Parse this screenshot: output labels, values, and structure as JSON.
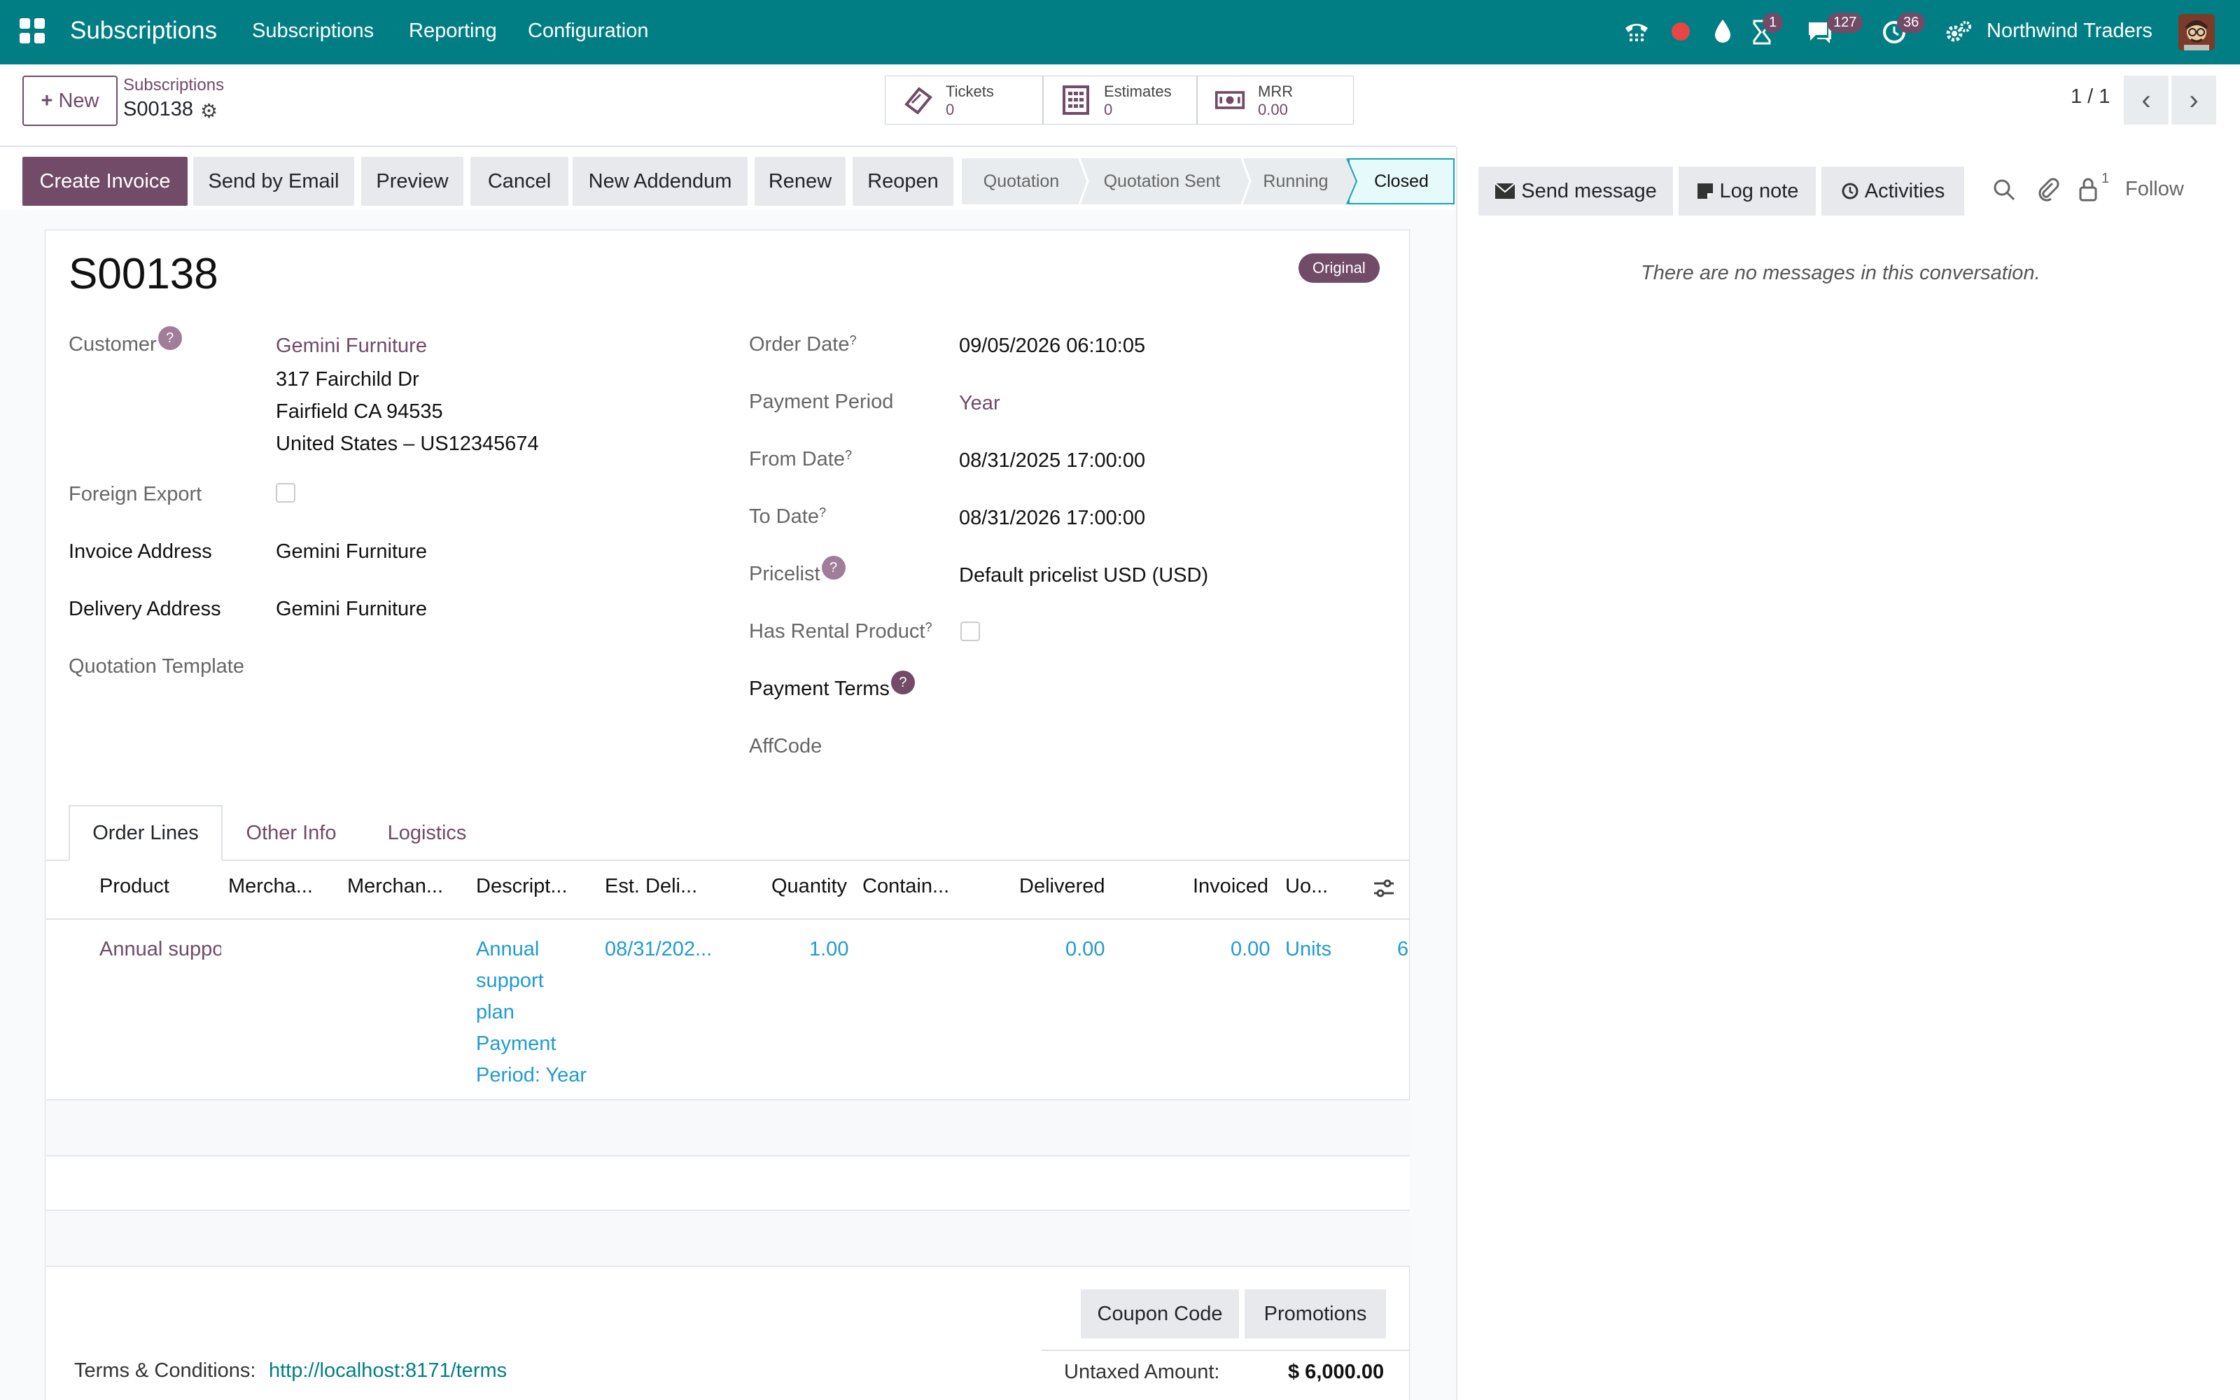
{
  "topnav": {
    "app_name": "Subscriptions",
    "menus": [
      "Subscriptions",
      "Reporting",
      "Configuration"
    ],
    "badges": {
      "activity_timer": "1",
      "messages": "127",
      "clock": "36"
    },
    "company": "Northwind Traders"
  },
  "control_panel": {
    "new_label": "New",
    "breadcrumb_parent": "Subscriptions",
    "breadcrumb_current": "S00138",
    "smart_buttons": [
      {
        "label": "Tickets",
        "value": "0"
      },
      {
        "label": "Estimates",
        "value": "0"
      },
      {
        "label": "MRR",
        "value": "0.00"
      }
    ],
    "pager": "1 / 1"
  },
  "actions": {
    "create_invoice": "Create Invoice",
    "send_by_email": "Send by Email",
    "preview": "Preview",
    "cancel": "Cancel",
    "new_addendum": "New Addendum",
    "renew": "Renew",
    "reopen": "Reopen"
  },
  "stages": [
    "Quotation",
    "Quotation Sent",
    "Running",
    "Closed"
  ],
  "record": {
    "name": "S00138",
    "ribbon": "Original",
    "customer_label": "Customer",
    "customer_name": "Gemini Furniture",
    "address_line1": "317 Fairchild Dr",
    "address_line2": "Fairfield CA 94535",
    "address_line3": "United States – US12345674",
    "foreign_export_label": "Foreign Export",
    "invoice_address_label": "Invoice Address",
    "invoice_address": "Gemini Furniture",
    "delivery_address_label": "Delivery Address",
    "delivery_address": "Gemini Furniture",
    "quotation_template_label": "Quotation Template",
    "order_date_label": "Order Date",
    "order_date": "09/05/2026 06:10:05",
    "payment_period_label": "Payment Period",
    "payment_period": "Year",
    "from_date_label": "From Date",
    "from_date": "08/31/2025 17:00:00",
    "to_date_label": "To Date",
    "to_date": "08/31/2026 17:00:00",
    "pricelist_label": "Pricelist",
    "pricelist": "Default pricelist USD (USD)",
    "has_rental_label": "Has Rental Product",
    "payment_terms_label": "Payment Terms",
    "affcode_label": "AffCode"
  },
  "tabs": [
    "Order Lines",
    "Other Info",
    "Logistics"
  ],
  "order_lines": {
    "headers": [
      "Product",
      "Mercha...",
      "Merchan...",
      "Descript...",
      "Est. Deli...",
      "Quantity",
      "Contain...",
      "Delivered",
      "Invoiced",
      "Uo..."
    ],
    "rows": [
      {
        "product": "Annual suppo",
        "description": [
          "Annual",
          "support",
          "plan",
          "Payment",
          "Period: Year"
        ],
        "est_delivery": "08/31/202...",
        "quantity": "1.00",
        "delivered": "0.00",
        "invoiced": "0.00",
        "uom": "Units",
        "overflow": "6"
      }
    ]
  },
  "footer": {
    "coupon_code": "Coupon Code",
    "promotions": "Promotions",
    "terms_label": "Terms & Conditions:",
    "terms_link": "http://localhost:8171/terms",
    "untaxed_label": "Untaxed Amount:",
    "untaxed_value": "$ 6,000.00"
  },
  "chatter": {
    "send_message": "Send message",
    "log_note": "Log note",
    "activities": "Activities",
    "followers_count": "1",
    "follow": "Follow",
    "empty": "There are no messages in this conversation."
  },
  "colors": {
    "brand": "#017e84",
    "primary": "#714b67",
    "link_blue": "#1f9bd1"
  }
}
